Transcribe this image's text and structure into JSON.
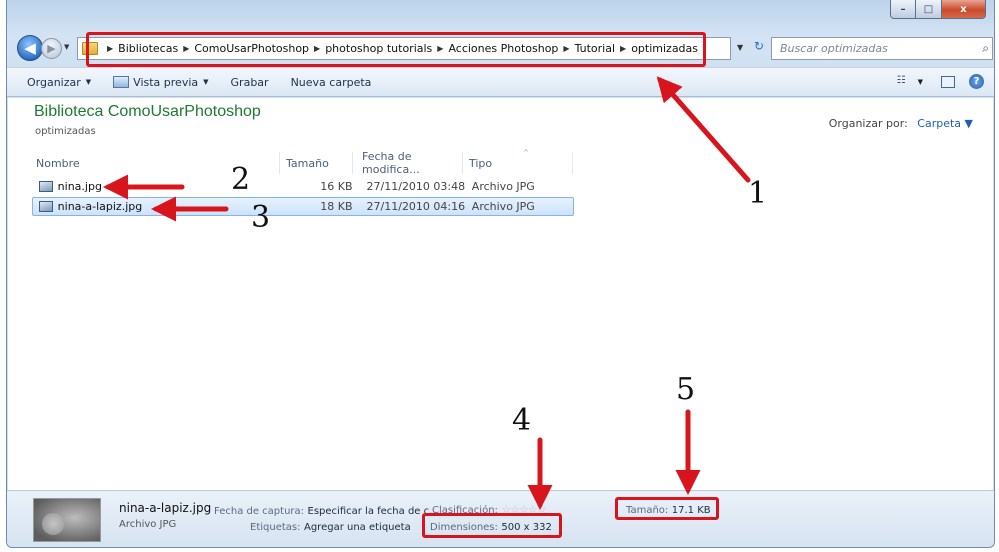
{
  "window": {
    "caption_min": "–",
    "caption_max": "□",
    "caption_close": "x"
  },
  "nav": {
    "back_glyph": "◀",
    "forward_glyph": "▶",
    "dropdown_glyph": "▼",
    "crumbs": [
      "Bibliotecas",
      "ComoUsarPhotoshop",
      "photoshop tutorials",
      "Acciones Photoshop",
      "Tutorial",
      "optimizadas"
    ],
    "crumb_separator": "▶",
    "refresh_glyph": "↻",
    "search_placeholder": "Buscar optimizadas",
    "search_glyph": "⌕"
  },
  "toolbar": {
    "organize": "Organizar",
    "preview": "Vista previa",
    "burn": "Grabar",
    "new_folder": "Nueva carpeta",
    "dropdown_glyph": "▼",
    "help_glyph": "?"
  },
  "library": {
    "title": "Biblioteca ComoUsarPhotoshop",
    "subtitle": "optimizadas",
    "arrange_label": "Organizar por:",
    "arrange_value": "Carpeta ▼"
  },
  "columns": {
    "name": "Nombre",
    "size": "Tamaño",
    "date": "Fecha de modifica...",
    "type": "Tipo"
  },
  "files": [
    {
      "name": "nina.jpg",
      "size": "16 KB",
      "date": "27/11/2010 03:48 ...",
      "type": "Archivo JPG"
    },
    {
      "name": "nina-a-lapiz.jpg",
      "size": "18 KB",
      "date": "27/11/2010 04:16 ...",
      "type": "Archivo JPG"
    }
  ],
  "details": {
    "name": "nina-a-lapiz.jpg",
    "type": "Archivo JPG",
    "capture_label": "Fecha de captura:",
    "capture_value": "Especificar la fecha de c...",
    "rating_label": "Clasificación:",
    "rating_stars": "☆☆☆☆☆",
    "tags_label": "Etiquetas:",
    "tags_value": "Agregar una etiqueta",
    "dimensions_label": "Dimensiones:",
    "dimensions_value": "500 x 332",
    "size_label": "Tamaño:",
    "size_value": "17.1 KB"
  },
  "annotations": {
    "n1": "1",
    "n2": "2",
    "n3": "3",
    "n4": "4",
    "n5": "5"
  },
  "colors": {
    "annotation": "#d8141c",
    "library_title": "#1e7a32",
    "link": "#1e5fb0"
  }
}
